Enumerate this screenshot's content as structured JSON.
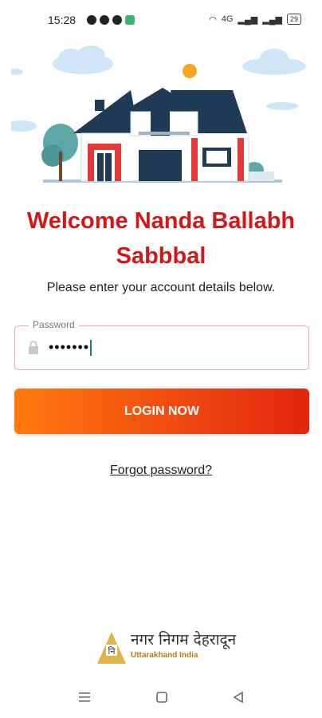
{
  "status_bar": {
    "time": "15:28",
    "battery": "29",
    "network": "4G"
  },
  "welcome": {
    "title": "Welcome Nanda Ballabh Sabbbal",
    "instruction": "Please enter your account details below."
  },
  "password": {
    "label": "Password",
    "value": "•••••••"
  },
  "actions": {
    "login": "LOGIN NOW",
    "forgot": "Forgot password?"
  },
  "footer": {
    "org_name": "नगर निगम देहरादून",
    "org_sub": "Uttarakhand India"
  },
  "colors": {
    "accent": "#d01818",
    "button_start": "#ff7a0d",
    "button_end": "#e1260f",
    "house_roof": "#1f3a55",
    "house_red": "#e23a3a"
  }
}
